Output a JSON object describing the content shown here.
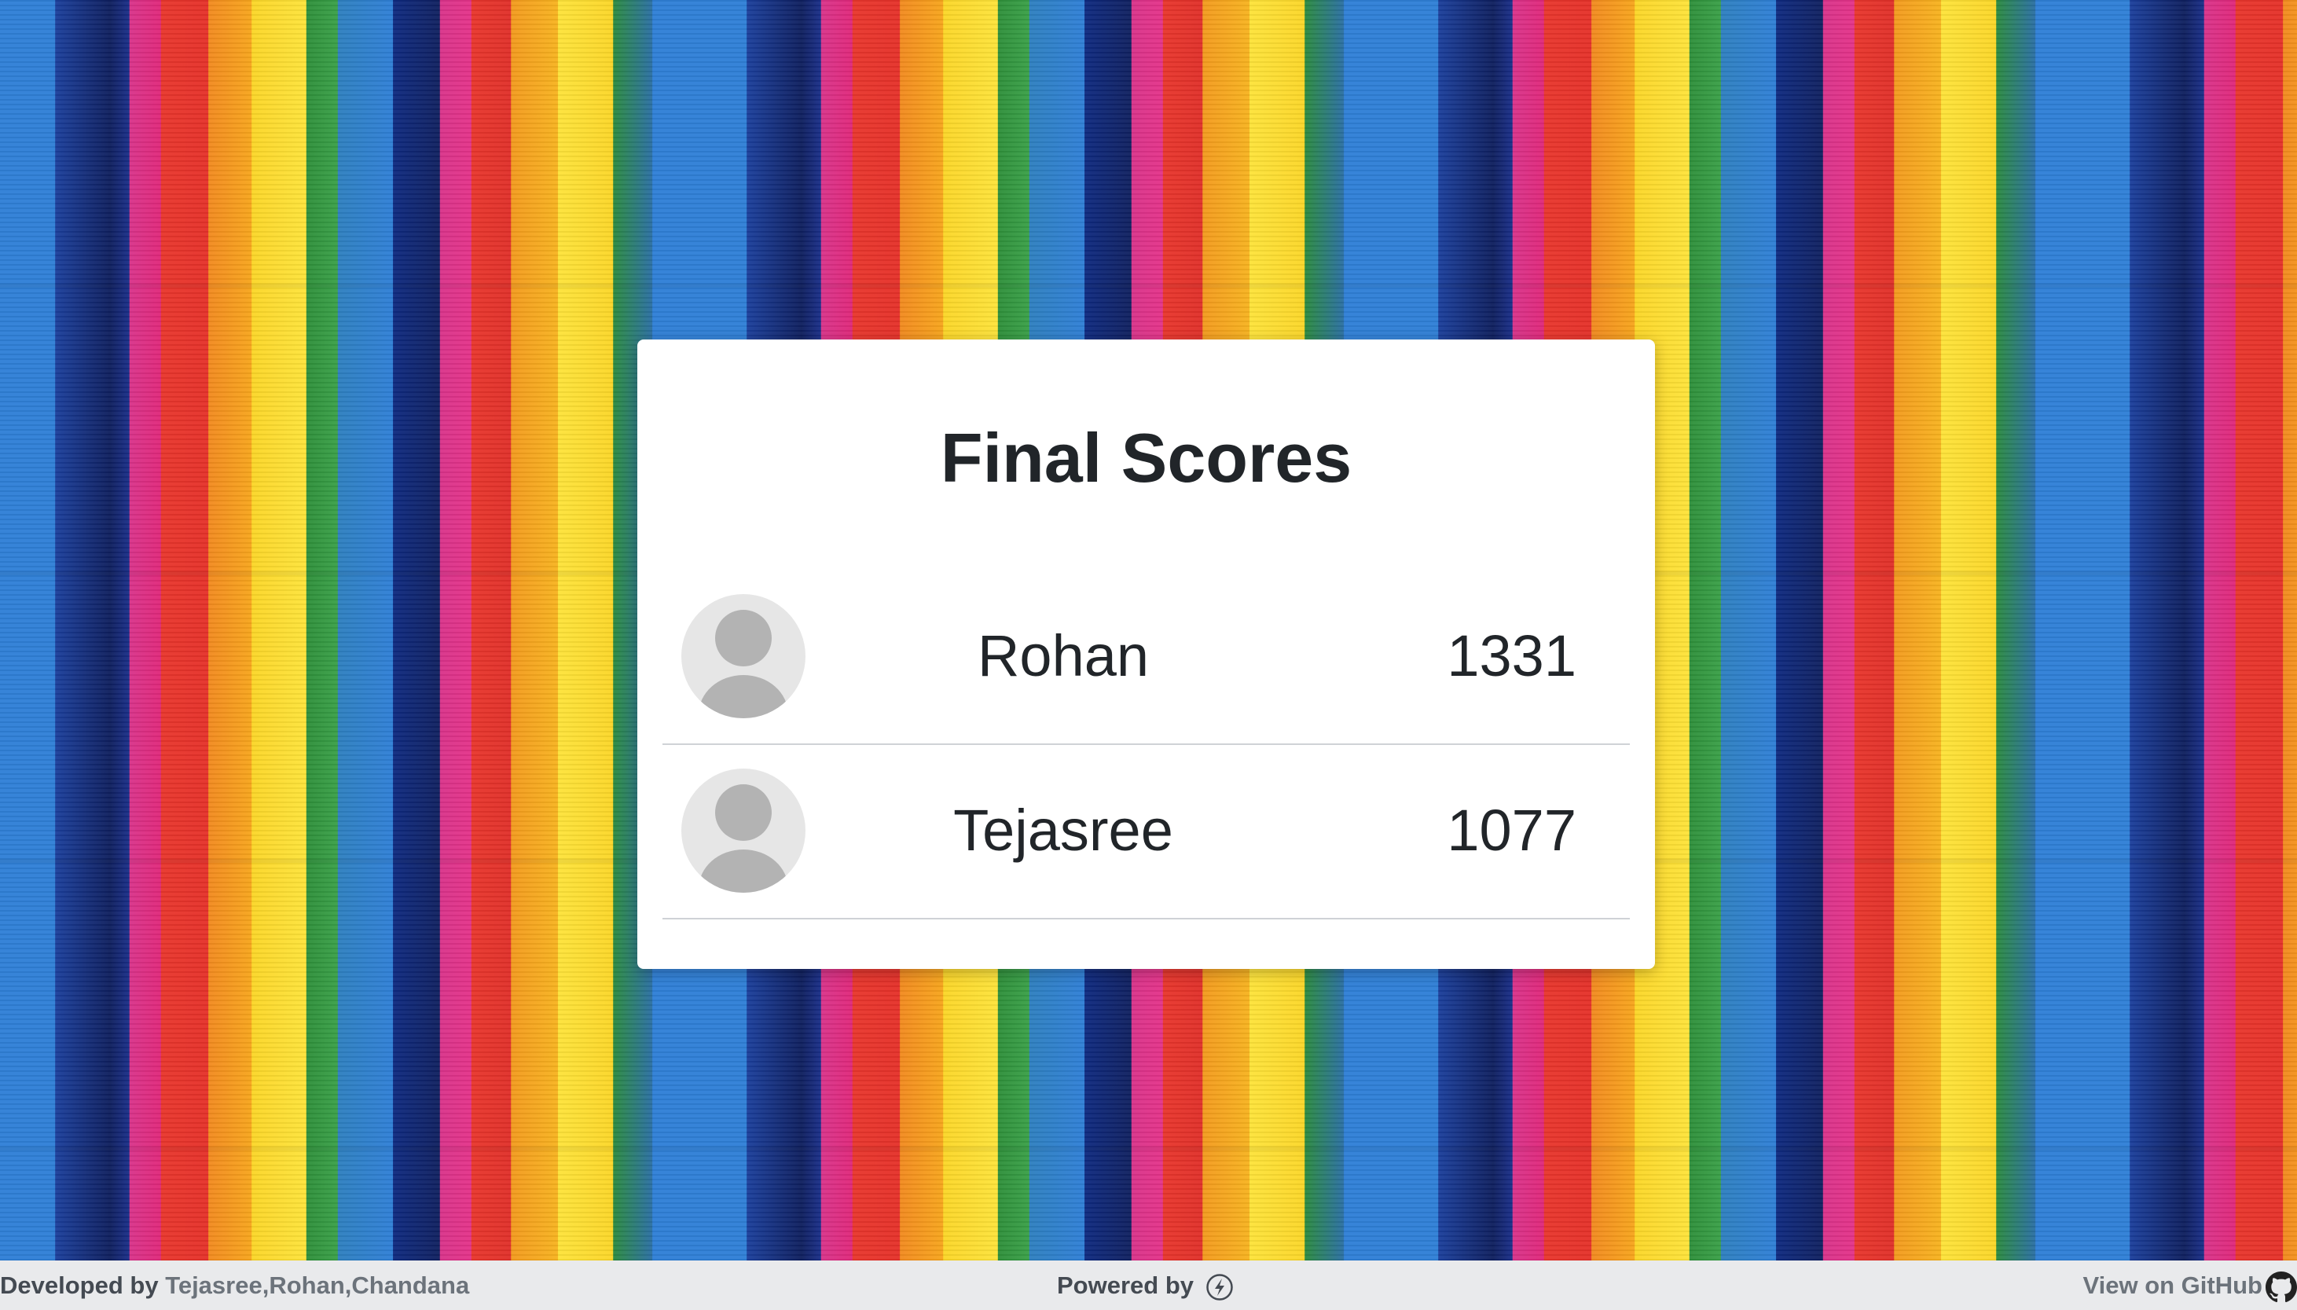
{
  "card": {
    "title": "Final Scores"
  },
  "players": [
    {
      "name": "Rohan",
      "score": "1331",
      "avatar_icon": "user-avatar-icon"
    },
    {
      "name": "Tejasree",
      "score": "1077",
      "avatar_icon": "user-avatar-icon"
    }
  ],
  "footer": {
    "developed_label": "Developed by ",
    "developers": "Tejasree,Rohan,Chandana",
    "powered_label": "Powered by ",
    "powered_icon": "lightning-bolt-icon",
    "github_link": "View on GitHub",
    "github_icon": "github-icon"
  },
  "colors": {
    "card_background": "#ffffff",
    "text": "#212529",
    "footer_background": "#e9eaec",
    "muted_link": "#6c737b",
    "avatar_background": "#e6e6e6",
    "avatar_silhouette": "#b3b3b3"
  }
}
